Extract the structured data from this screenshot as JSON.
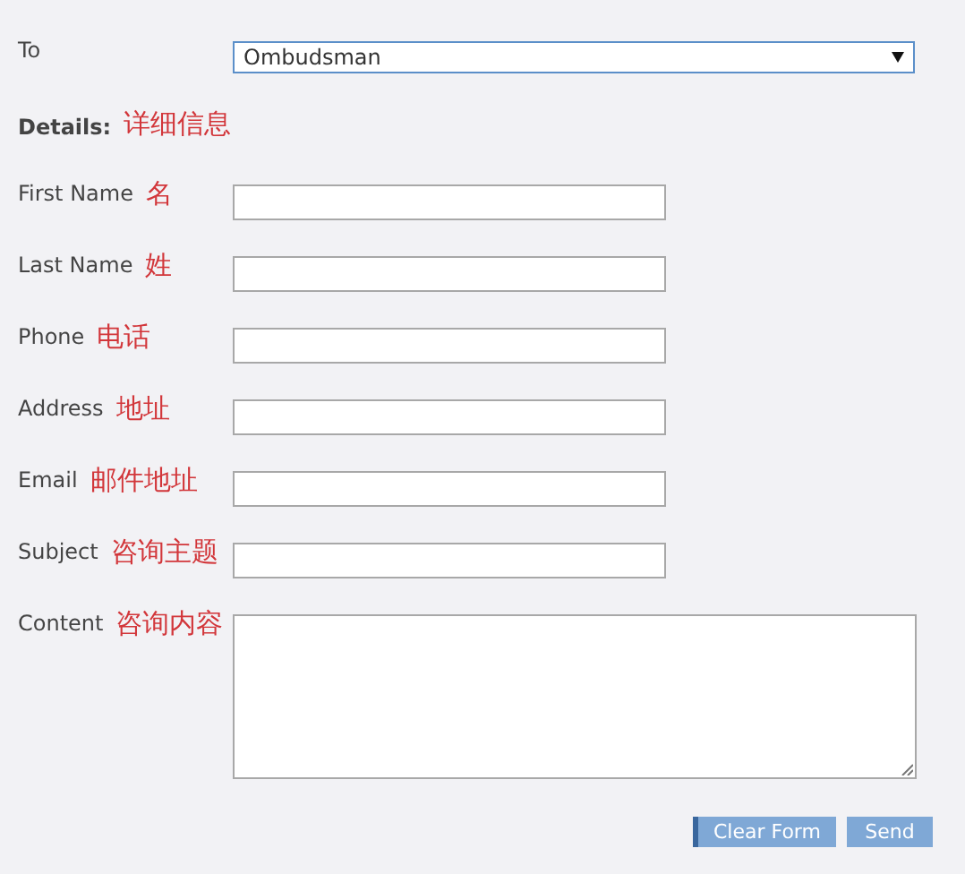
{
  "to": {
    "label": "To",
    "value": "Ombudsman"
  },
  "details": {
    "label": "Details:",
    "note": "详细信息"
  },
  "fields": [
    {
      "label": "First Name",
      "note": "名",
      "kind": "text"
    },
    {
      "label": "Last Name",
      "note": "姓",
      "kind": "text"
    },
    {
      "label": "Phone",
      "note": "电话",
      "kind": "text"
    },
    {
      "label": "Address",
      "note": "地址",
      "kind": "text"
    },
    {
      "label": "Email",
      "note": "邮件地址",
      "kind": "text"
    },
    {
      "label": "Subject",
      "note": "咨询主题",
      "kind": "text"
    },
    {
      "label": "Content",
      "note": "咨询内容",
      "kind": "textarea"
    }
  ],
  "buttons": [
    {
      "label": "Clear Form",
      "kind": "reset"
    },
    {
      "label": "Send",
      "kind": "submit"
    }
  ]
}
